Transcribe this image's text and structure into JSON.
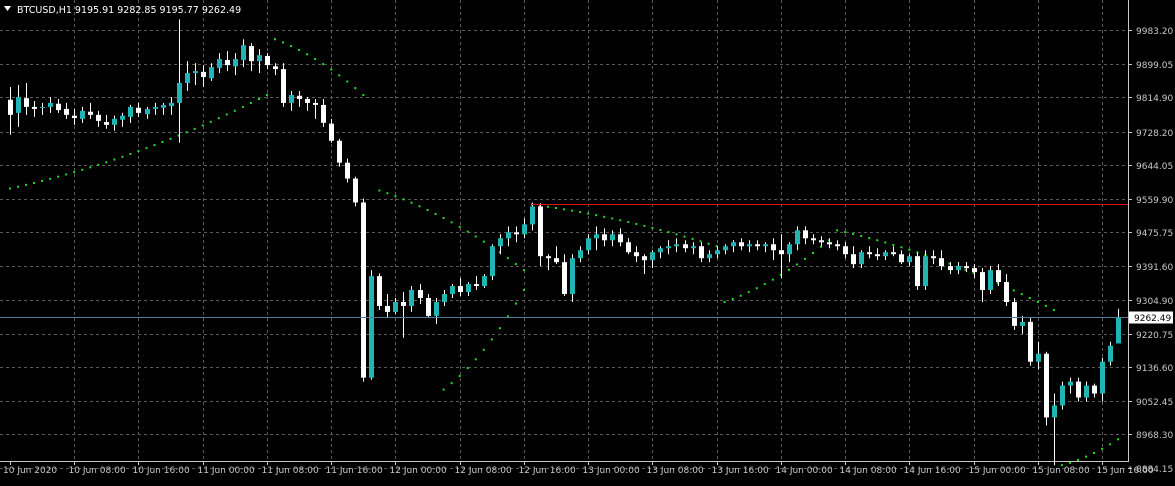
{
  "header": {
    "symbol_line": "BTCUSD,H1  9195.91 9282.85 9195.77 9262.49"
  },
  "colors": {
    "background": "#000000",
    "grid": "#5a5a5a",
    "axis": "#c8c8c8",
    "bull": "#1fb5b5",
    "bear": "#ffffff",
    "wick": "#ffffff",
    "sar": "#22e022",
    "resistance": "#e01010",
    "bid_line": "#4f7f96"
  },
  "chart_data": {
    "type": "candlestick",
    "title": "BTCUSD,H1",
    "ohlc_readout": {
      "open": 9195.91,
      "high": 9282.85,
      "low": 9195.77,
      "close": 9262.49
    },
    "current_price": 9262.49,
    "current_price_label": "9262.49",
    "ylim": [
      8850,
      10030
    ],
    "y_tick_labels": [
      "9983.20",
      "9899.05",
      "9814.90",
      "9728.20",
      "9644.05",
      "9559.90",
      "9475.75",
      "9391.60",
      "9304.90",
      "9220.75",
      "9136.60",
      "9052.45",
      "8968.30",
      "8884.15"
    ],
    "y_tick_values": [
      9983.2,
      9899.05,
      9814.9,
      9728.2,
      9644.05,
      9559.9,
      9475.75,
      9391.6,
      9304.9,
      9220.75,
      9136.6,
      9052.45,
      8968.3,
      8884.15
    ],
    "x_tick_labels": [
      "10 Jun 2020",
      "10 Jun 08:00",
      "10 Jun 16:00",
      "11 Jun 00:00",
      "11 Jun 08:00",
      "11 Jun 16:00",
      "12 Jun 00:00",
      "12 Jun 08:00",
      "12 Jun 16:00",
      "13 Jun 00:00",
      "13 Jun 08:00",
      "13 Jun 16:00",
      "14 Jun 00:00",
      "14 Jun 08:00",
      "14 Jun 16:00",
      "15 Jun 00:00",
      "15 Jun 08:00",
      "15 Jun 16:00"
    ],
    "x_tick_bar_index": [
      0,
      8,
      16,
      24,
      32,
      40,
      48,
      56,
      64,
      72,
      80,
      88,
      96,
      104,
      112,
      120,
      128,
      136
    ],
    "grid": true,
    "resistance_level": 9545,
    "resistance_start_bar": 65,
    "candles": [
      [
        9808,
        9840,
        9720,
        9770
      ],
      [
        9775,
        9845,
        9740,
        9815
      ],
      [
        9812,
        9850,
        9770,
        9790
      ],
      [
        9790,
        9805,
        9765,
        9785
      ],
      [
        9788,
        9800,
        9770,
        9790
      ],
      [
        9790,
        9815,
        9775,
        9800
      ],
      [
        9798,
        9810,
        9775,
        9782
      ],
      [
        9785,
        9800,
        9760,
        9770
      ],
      [
        9768,
        9785,
        9745,
        9762
      ],
      [
        9760,
        9790,
        9750,
        9780
      ],
      [
        9778,
        9800,
        9760,
        9770
      ],
      [
        9770,
        9780,
        9740,
        9755
      ],
      [
        9752,
        9770,
        9735,
        9745
      ],
      [
        9745,
        9768,
        9730,
        9760
      ],
      [
        9758,
        9775,
        9740,
        9768
      ],
      [
        9765,
        9795,
        9750,
        9790
      ],
      [
        9788,
        9800,
        9765,
        9775
      ],
      [
        9772,
        9790,
        9760,
        9785
      ],
      [
        9785,
        9800,
        9770,
        9790
      ],
      [
        9788,
        9800,
        9770,
        9795
      ],
      [
        9792,
        9815,
        9770,
        9800
      ],
      [
        9800,
        10010,
        9700,
        9850
      ],
      [
        9850,
        9905,
        9830,
        9875
      ],
      [
        9875,
        9900,
        9845,
        9880
      ],
      [
        9878,
        9895,
        9840,
        9865
      ],
      [
        9862,
        9900,
        9855,
        9890
      ],
      [
        9888,
        9925,
        9875,
        9910
      ],
      [
        9908,
        9930,
        9880,
        9895
      ],
      [
        9892,
        9925,
        9870,
        9910
      ],
      [
        9908,
        9960,
        9890,
        9945
      ],
      [
        9943,
        9950,
        9880,
        9905
      ],
      [
        9905,
        9935,
        9875,
        9920
      ],
      [
        9918,
        9925,
        9885,
        9895
      ],
      [
        9892,
        9900,
        9870,
        9885
      ],
      [
        9885,
        9900,
        9790,
        9800
      ],
      [
        9800,
        9830,
        9780,
        9820
      ],
      [
        9818,
        9830,
        9790,
        9810
      ],
      [
        9810,
        9815,
        9780,
        9800
      ],
      [
        9800,
        9810,
        9760,
        9795
      ],
      [
        9795,
        9810,
        9740,
        9750
      ],
      [
        9748,
        9760,
        9700,
        9705
      ],
      [
        9705,
        9710,
        9640,
        9650
      ],
      [
        9650,
        9660,
        9600,
        9610
      ],
      [
        9610,
        9615,
        9540,
        9550
      ],
      [
        9550,
        9560,
        9100,
        9110
      ],
      [
        9110,
        9380,
        9105,
        9365
      ],
      [
        9365,
        9372,
        9280,
        9290
      ],
      [
        9290,
        9320,
        9260,
        9275
      ],
      [
        9275,
        9310,
        9270,
        9300
      ],
      [
        9300,
        9325,
        9210,
        9290
      ],
      [
        9290,
        9340,
        9275,
        9330
      ],
      [
        9330,
        9345,
        9295,
        9310
      ],
      [
        9310,
        9320,
        9260,
        9265
      ],
      [
        9265,
        9310,
        9245,
        9300
      ],
      [
        9300,
        9330,
        9290,
        9320
      ],
      [
        9320,
        9345,
        9310,
        9340
      ],
      [
        9340,
        9360,
        9315,
        9325
      ],
      [
        9325,
        9350,
        9315,
        9345
      ],
      [
        9345,
        9365,
        9330,
        9340
      ],
      [
        9340,
        9370,
        9335,
        9365
      ],
      [
        9365,
        9445,
        9355,
        9440
      ],
      [
        9440,
        9470,
        9420,
        9460
      ],
      [
        9460,
        9490,
        9440,
        9475
      ],
      [
        9475,
        9490,
        9450,
        9470
      ],
      [
        9470,
        9510,
        9460,
        9495
      ],
      [
        9495,
        9550,
        9480,
        9540
      ],
      [
        9540,
        9548,
        9390,
        9415
      ],
      [
        9415,
        9420,
        9380,
        9410
      ],
      [
        9410,
        9440,
        9395,
        9400
      ],
      [
        9400,
        9420,
        9315,
        9320
      ],
      [
        9320,
        9420,
        9300,
        9410
      ],
      [
        9410,
        9440,
        9400,
        9430
      ],
      [
        9430,
        9470,
        9420,
        9460
      ],
      [
        9460,
        9490,
        9430,
        9470
      ],
      [
        9470,
        9485,
        9440,
        9455
      ],
      [
        9455,
        9480,
        9440,
        9470
      ],
      [
        9470,
        9485,
        9440,
        9450
      ],
      [
        9450,
        9460,
        9420,
        9425
      ],
      [
        9425,
        9440,
        9400,
        9415
      ],
      [
        9415,
        9420,
        9370,
        9405
      ],
      [
        9405,
        9430,
        9385,
        9425
      ],
      [
        9425,
        9440,
        9410,
        9435
      ],
      [
        9435,
        9455,
        9420,
        9440
      ],
      [
        9440,
        9460,
        9425,
        9445
      ],
      [
        9445,
        9455,
        9425,
        9435
      ],
      [
        9435,
        9450,
        9420,
        9440
      ],
      [
        9440,
        9450,
        9400,
        9410
      ],
      [
        9410,
        9430,
        9400,
        9420
      ],
      [
        9420,
        9440,
        9410,
        9430
      ],
      [
        9430,
        9445,
        9420,
        9440
      ],
      [
        9440,
        9455,
        9425,
        9450
      ],
      [
        9450,
        9460,
        9430,
        9440
      ],
      [
        9440,
        9455,
        9425,
        9445
      ],
      [
        9445,
        9455,
        9430,
        9440
      ],
      [
        9440,
        9450,
        9425,
        9445
      ],
      [
        9445,
        9460,
        9405,
        9430
      ],
      [
        9430,
        9470,
        9360,
        9420
      ],
      [
        9420,
        9450,
        9400,
        9445
      ],
      [
        9445,
        9490,
        9430,
        9480
      ],
      [
        9480,
        9490,
        9445,
        9460
      ],
      [
        9460,
        9470,
        9445,
        9455
      ],
      [
        9455,
        9465,
        9440,
        9450
      ],
      [
        9450,
        9460,
        9435,
        9445
      ],
      [
        9445,
        9455,
        9430,
        9440
      ],
      [
        9440,
        9450,
        9410,
        9420
      ],
      [
        9420,
        9440,
        9385,
        9395
      ],
      [
        9395,
        9430,
        9385,
        9425
      ],
      [
        9425,
        9440,
        9410,
        9420
      ],
      [
        9420,
        9435,
        9405,
        9415
      ],
      [
        9415,
        9430,
        9405,
        9425
      ],
      [
        9425,
        9440,
        9415,
        9420
      ],
      [
        9420,
        9430,
        9395,
        9400
      ],
      [
        9400,
        9420,
        9390,
        9415
      ],
      [
        9415,
        9425,
        9330,
        9340
      ],
      [
        9340,
        9430,
        9330,
        9415
      ],
      [
        9415,
        9430,
        9395,
        9410
      ],
      [
        9410,
        9430,
        9380,
        9390
      ],
      [
        9390,
        9400,
        9370,
        9380
      ],
      [
        9380,
        9400,
        9370,
        9390
      ],
      [
        9390,
        9400,
        9375,
        9385
      ],
      [
        9385,
        9395,
        9360,
        9375
      ],
      [
        9375,
        9385,
        9300,
        9330
      ],
      [
        9330,
        9390,
        9320,
        9380
      ],
      [
        9380,
        9395,
        9340,
        9350
      ],
      [
        9350,
        9370,
        9290,
        9300
      ],
      [
        9300,
        9310,
        9230,
        9240
      ],
      [
        9240,
        9265,
        9220,
        9250
      ],
      [
        9250,
        9260,
        9140,
        9150
      ],
      [
        9150,
        9200,
        9130,
        9170
      ],
      [
        9170,
        9175,
        8990,
        9010
      ],
      [
        9010,
        9070,
        8890,
        9040
      ],
      [
        9040,
        9100,
        9030,
        9090
      ],
      [
        9090,
        9110,
        9070,
        9100
      ],
      [
        9100,
        9110,
        9050,
        9060
      ],
      [
        9060,
        9100,
        9050,
        9090
      ],
      [
        9090,
        9095,
        9060,
        9070
      ],
      [
        9070,
        9160,
        9050,
        9150
      ],
      [
        9150,
        9200,
        9140,
        9190
      ],
      [
        9195.91,
        9282.85,
        9195.77,
        9262.49
      ]
    ],
    "sar": {
      "segments": [
        {
          "from": 0,
          "to": 32,
          "start": 9585,
          "end": 9820
        },
        {
          "from": 33,
          "to": 44,
          "start": 9960,
          "end": 9820
        },
        {
          "from": 46,
          "to": 64,
          "start": 9580,
          "end": 9380
        },
        {
          "from": 54,
          "to": 64,
          "start": 9080,
          "end": 9330
        },
        {
          "from": 65,
          "to": 88,
          "start": 9545,
          "end": 9440
        },
        {
          "from": 89,
          "to": 102,
          "start": 9300,
          "end": 9455
        },
        {
          "from": 103,
          "to": 130,
          "start": 9480,
          "end": 9280
        },
        {
          "from": 131,
          "to": 138,
          "start": 8890,
          "end": 8955
        }
      ]
    }
  }
}
